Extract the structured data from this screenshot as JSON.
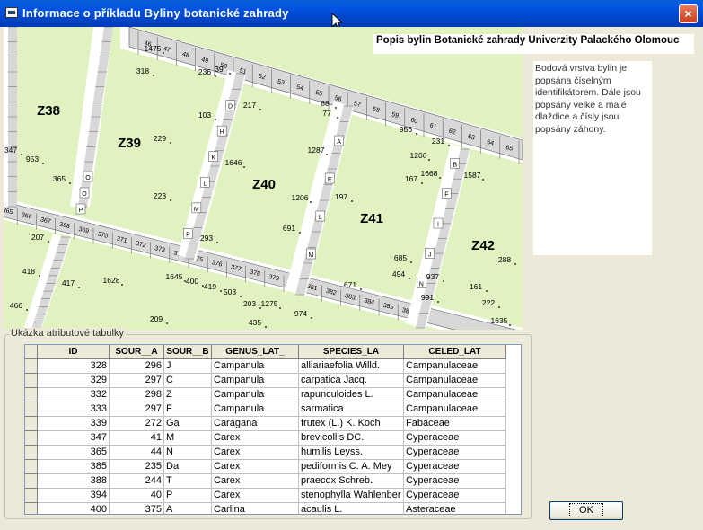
{
  "window": {
    "title": "Informace o příkladu Byliny botanické zahrady",
    "close_label": "×"
  },
  "map": {
    "heading": "Popis bylin Botanické zahrady Univerzity Palackého Olomouc",
    "zones": [
      "Z38",
      "Z39",
      "Z40",
      "Z41",
      "Z42"
    ],
    "tile_numbers_top": [
      "46",
      "47",
      "48",
      "49",
      "50",
      "51",
      "52",
      "53",
      "54",
      "55",
      "56",
      "57",
      "58",
      "59",
      "60",
      "61",
      "62",
      "63",
      "64",
      "65",
      "66"
    ],
    "tile_numbers_middle": [
      "365",
      "366",
      "367",
      "368",
      "369",
      "370",
      "371",
      "372",
      "373",
      "374",
      "375",
      "376",
      "377",
      "378",
      "379",
      "380",
      "381",
      "382",
      "383",
      "384",
      "385",
      "386"
    ],
    "letters_left": [
      "O",
      "O",
      "P"
    ],
    "letters_mid": [
      "D",
      "H",
      "K",
      "L",
      "M",
      "P"
    ],
    "letters_right1": [
      "A",
      "E",
      "L",
      "M"
    ],
    "letters_right2": [
      "B",
      "F",
      "I",
      "J",
      "N"
    ],
    "points": [
      {
        "label": "1475"
      },
      {
        "label": "318"
      },
      {
        "label": "236"
      },
      {
        "label": "39"
      },
      {
        "label": "103"
      },
      {
        "label": "217"
      },
      {
        "label": "88"
      },
      {
        "label": "77"
      },
      {
        "label": "956"
      },
      {
        "label": "231"
      },
      {
        "label": "229"
      },
      {
        "label": "1646"
      },
      {
        "label": "1287"
      },
      {
        "label": "1206"
      },
      {
        "label": "1668"
      },
      {
        "label": "1587"
      },
      {
        "label": "347"
      },
      {
        "label": "953"
      },
      {
        "label": "365"
      },
      {
        "label": "223"
      },
      {
        "label": "167"
      },
      {
        "label": "1206"
      },
      {
        "label": "197"
      },
      {
        "label": "691"
      },
      {
        "label": "207"
      },
      {
        "label": "293"
      },
      {
        "label": "685"
      },
      {
        "label": "288"
      },
      {
        "label": "494"
      },
      {
        "label": "937"
      },
      {
        "label": "418"
      },
      {
        "label": "417"
      },
      {
        "label": "1628"
      },
      {
        "label": "1645"
      },
      {
        "label": "400"
      },
      {
        "label": "419"
      },
      {
        "label": "503"
      },
      {
        "label": "671"
      },
      {
        "label": "991"
      },
      {
        "label": "161"
      },
      {
        "label": "466"
      },
      {
        "label": "203"
      },
      {
        "label": "1275"
      },
      {
        "label": "974"
      },
      {
        "label": "222"
      },
      {
        "label": "209"
      },
      {
        "label": "435"
      },
      {
        "label": "1635"
      }
    ]
  },
  "description": "Bodová vrstva bylin je popsána číselným identifikátorem. Dále jsou popsány velké a malé dlaždice a čísly jsou popsány záhony.",
  "table_group_label": "Ukázka atributové tabulky",
  "table": {
    "columns": [
      "ID",
      "SOUR__A",
      "SOUR__B",
      "GENUS_LAT_",
      "SPECIES_LA",
      "CELED_LAT"
    ],
    "rows": [
      [
        "328",
        "296",
        "J",
        "Campanula",
        "alliariaefolia Willd.",
        "Campanulaceae"
      ],
      [
        "329",
        "297",
        "C",
        "Campanula",
        "carpatica Jacq.",
        "Campanulaceae"
      ],
      [
        "332",
        "298",
        "Z",
        "Campanula",
        "rapunculoides L.",
        "Campanulaceae"
      ],
      [
        "333",
        "297",
        "F",
        "Campanula",
        "sarmatica",
        "Campanulaceae"
      ],
      [
        "339",
        "272",
        "Ga",
        "Caragana",
        "frutex (L.) K. Koch",
        "Fabaceae"
      ],
      [
        "347",
        "41",
        "M",
        "Carex",
        "brevicollis DC.",
        "Cyperaceae"
      ],
      [
        "365",
        "44",
        "N",
        "Carex",
        "humilis Leyss.",
        "Cyperaceae"
      ],
      [
        "385",
        "235",
        "Da",
        "Carex",
        "pediformis C. A. Mey",
        "Cyperaceae"
      ],
      [
        "388",
        "244",
        "T",
        "Carex",
        "praecox Schreb.",
        "Cyperaceae"
      ],
      [
        "394",
        "40",
        "P",
        "Carex",
        "stenophylla Wahlenber",
        "Cyperaceae"
      ],
      [
        "400",
        "375",
        "A",
        "Carlina",
        "acaulis L.",
        "Asteraceae"
      ]
    ]
  },
  "ok_label": "OK",
  "colors": {
    "bed": "#dff2c0",
    "path": "#ffffff",
    "tile": "#d8d8d8",
    "titlebar": "#0054e3",
    "dialog": "#ece9d8"
  }
}
